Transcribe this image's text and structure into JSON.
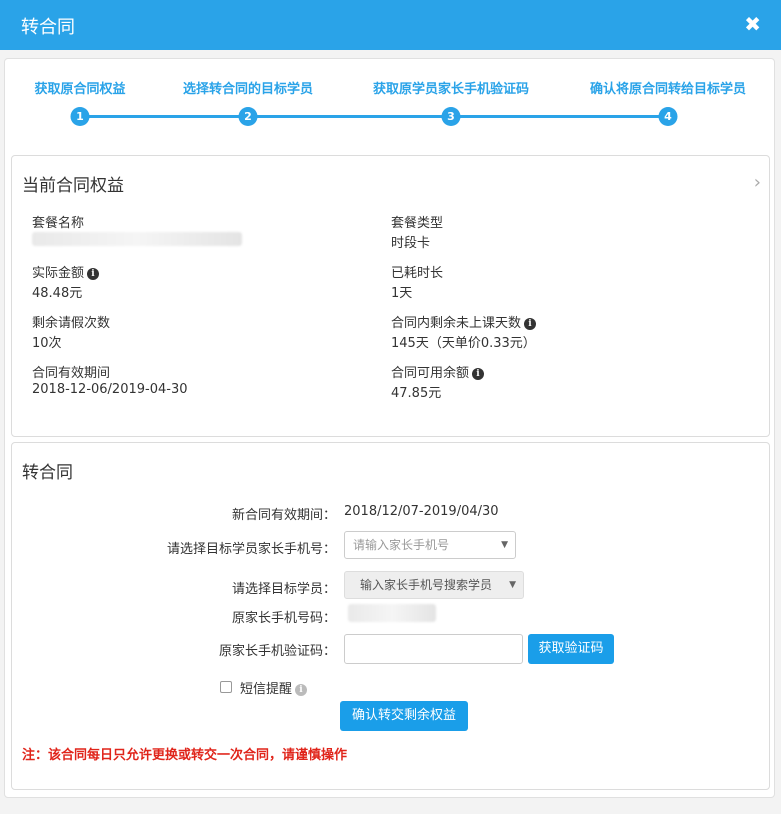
{
  "modal": {
    "title": "转合同",
    "close_symbol": "✖"
  },
  "steps": [
    {
      "label": "获取原合同权益",
      "num": "1"
    },
    {
      "label": "选择转合同的目标学员",
      "num": "2"
    },
    {
      "label": "获取原学员家长手机验证码",
      "num": "3"
    },
    {
      "label": "确认将原合同转给目标学员",
      "num": "4"
    }
  ],
  "current": {
    "title": "当前合同权益",
    "package_name_label": "套餐名称",
    "package_type_label": "套餐类型",
    "package_type_value": "时段卡",
    "actual_amount_label": "实际金额",
    "actual_amount_value": "48.48元",
    "consumed_label": "已耗时长",
    "consumed_value": "1天",
    "leave_label": "剩余请假次数",
    "leave_value": "10次",
    "remaining_days_label": "合同内剩余未上课天数",
    "remaining_days_value": "145天（天单价0.33元）",
    "valid_label": "合同有效期间",
    "valid_value": "2018-12-06/2019-04-30",
    "balance_label": "合同可用余额",
    "balance_value": "47.85元"
  },
  "transfer": {
    "title": "转合同",
    "new_valid_label": "新合同有效期间：",
    "new_valid_value": "2018/12/07-2019/04/30",
    "target_phone_label": "请选择目标学员家长手机号：",
    "target_phone_placeholder": "请输入家长手机号",
    "target_student_label": "请选择目标学员：",
    "target_student_placeholder": "输入家长手机号搜索学员",
    "orig_phone_label": "原家长手机号码：",
    "code_label": "原家长手机验证码：",
    "get_code_button": "获取验证码",
    "sms_label": "短信提醒",
    "confirm_button": "确认转交剩余权益",
    "warning": "注：该合同每日只允许更换或转交一次合同，请谨慎操作"
  },
  "colors": {
    "accent": "#2aa3e8",
    "warning": "#e0251b"
  }
}
